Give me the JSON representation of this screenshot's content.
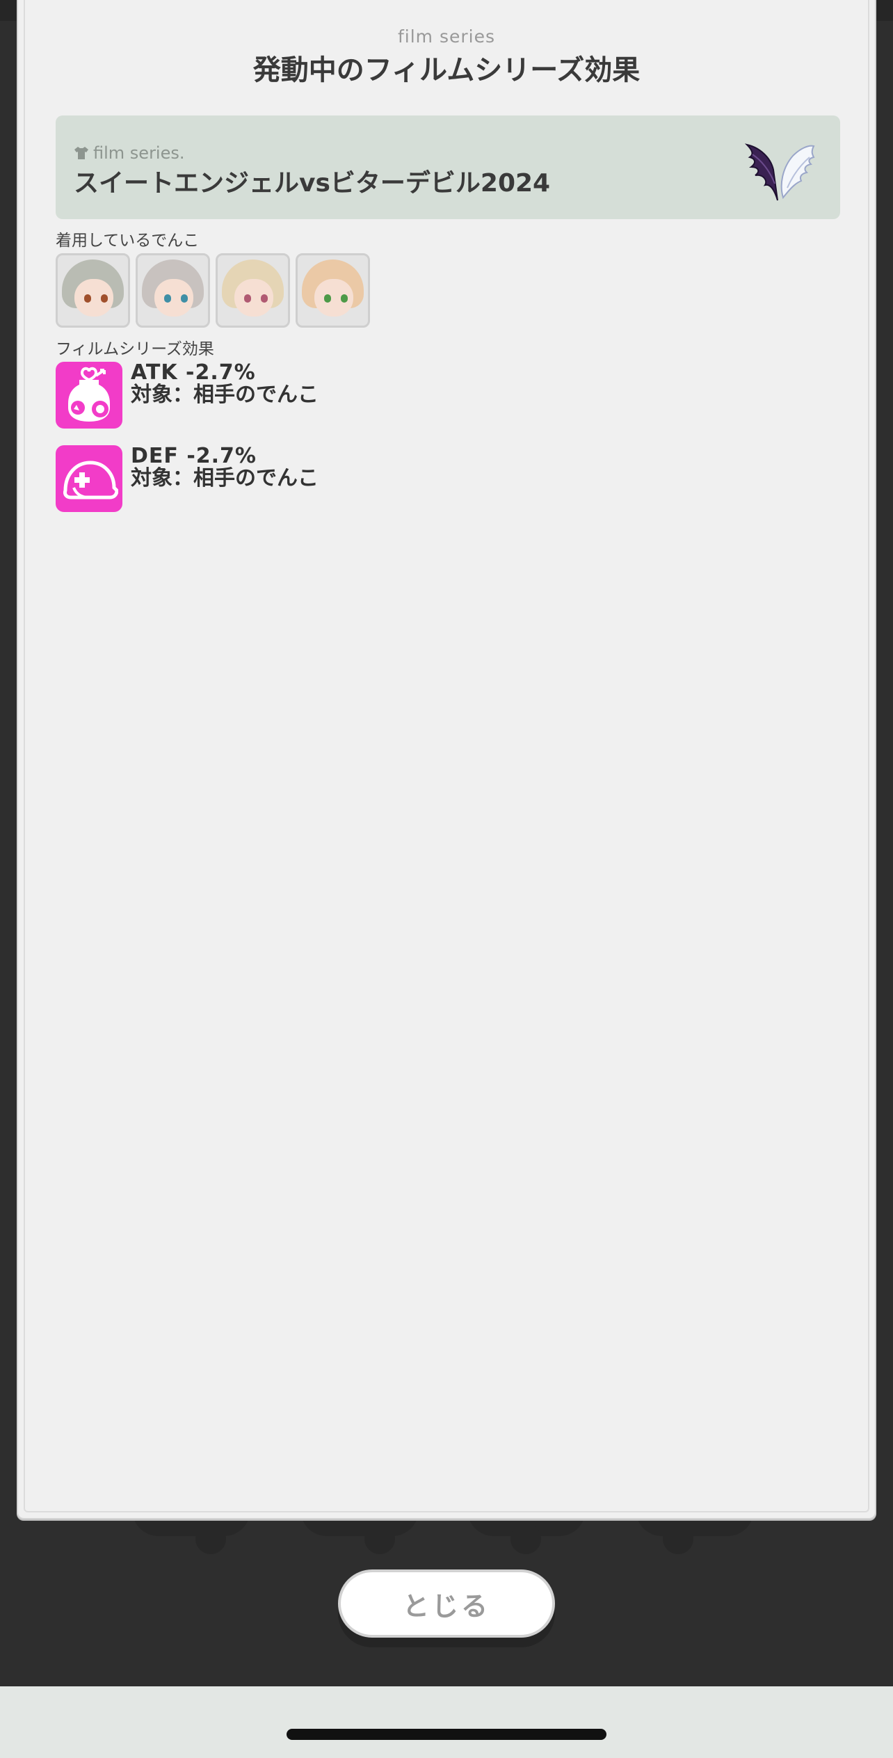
{
  "header": {
    "subtitle": "film series",
    "title": "発動中のフィルムシリーズ効果"
  },
  "series_card": {
    "sublabel": "film series.",
    "name": "スイートエンジェルvsビターデビル2024",
    "icon": "angel-devil-wings-icon"
  },
  "equipped": {
    "label": "着用しているでんこ",
    "avatars": [
      {
        "icon": "denco-avatar",
        "hair_color": "#b9bcb3"
      },
      {
        "icon": "denco-avatar",
        "hair_color": "#c8c2bf"
      },
      {
        "icon": "denco-avatar",
        "hair_color": "#e5d5b5"
      },
      {
        "icon": "denco-avatar",
        "hair_color": "#ebc9a6"
      }
    ]
  },
  "effects": {
    "label": "フィルムシリーズ効果",
    "items": [
      {
        "icon": "attack-robot-icon",
        "stat": "ATK -2.7%",
        "target": "対象：相手のでんこ"
      },
      {
        "icon": "defense-helmet-icon",
        "stat": "DEF -2.7%",
        "target": "対象：相手のでんこ"
      }
    ]
  },
  "footer": {
    "close_label": "とじる"
  },
  "colors": {
    "accent_pink": "#f23cc8",
    "card_bg": "#d5ded7",
    "modal_bg": "#f0f0f0",
    "backdrop": "#2e2e2e"
  }
}
